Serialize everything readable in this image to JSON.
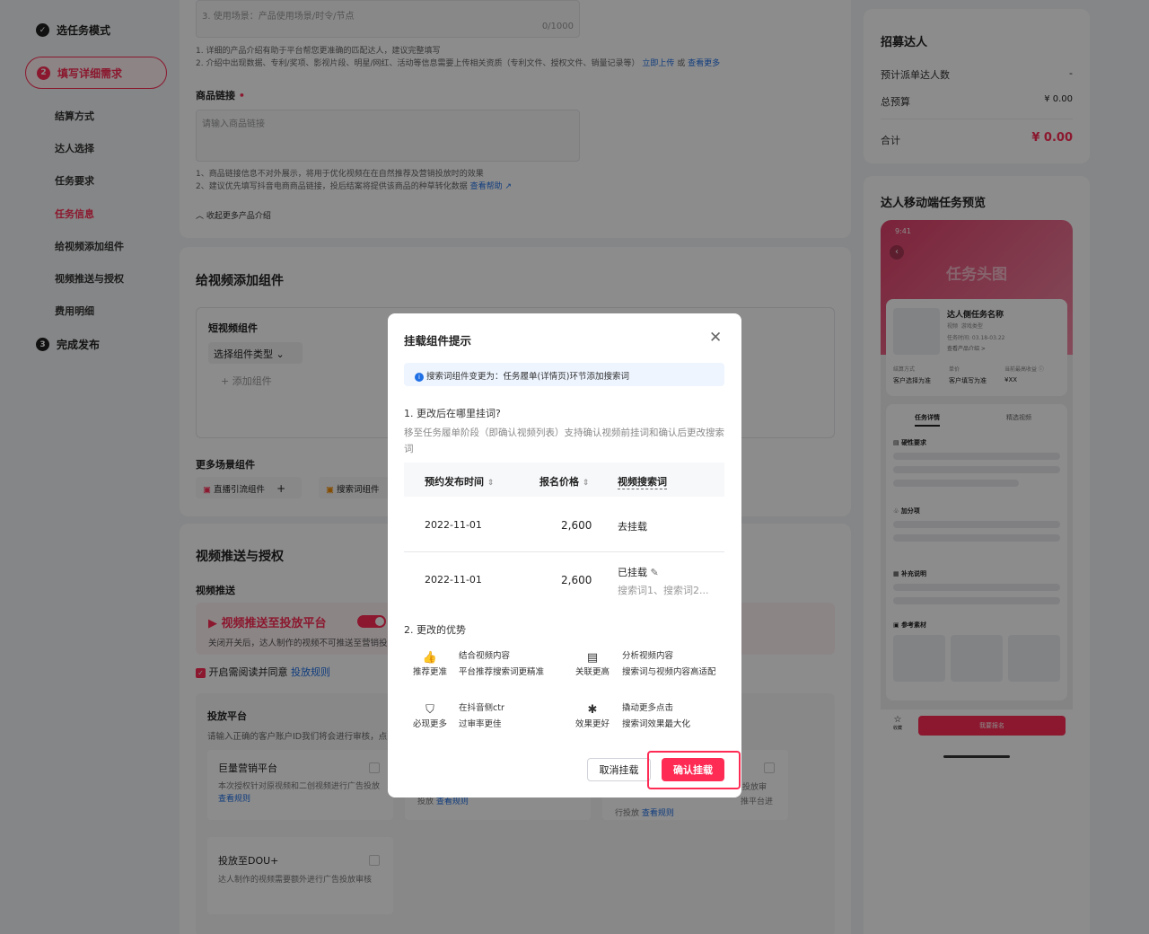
{
  "nav": {
    "step1": {
      "num": "✓",
      "label": "选任务模式"
    },
    "step2": {
      "num": "2",
      "label": "填写详细需求"
    },
    "step3": {
      "num": "3",
      "label": "完成发布"
    },
    "subs": [
      "结算方式",
      "达人选择",
      "任务要求",
      "任务信息",
      "给视频添加组件",
      "视频推送与授权",
      "费用明细"
    ]
  },
  "product": {
    "scene_placeholder": "3. 使用场景：产品使用场景/时令/节点",
    "counter": "0/1000",
    "tip1": "1. 详细的产品介绍有助于平台帮您更准确的匹配达人，建议完整填写",
    "tip2": "2. 介绍中出现数据、专利/奖项、影视片段、明星/网红、活动等信息需要上传相关资质（专利文件、授权文件、销量记录等）",
    "tip2_upload": "立即上传",
    "tip2_or": "或",
    "tip2_more": "查看更多",
    "link_label": "商品链接",
    "required": "•",
    "link_placeholder": "请输入商品链接",
    "link_tip1": "1、商品链接信息不对外展示，将用于优化视频在在自然推荐及营销投放时的效果",
    "link_tip2": "2、建议优先填写抖音电商商品链接，投后结案将提供该商品的种草转化数据",
    "link_help": "查看帮助",
    "collapse": "收起更多产品介绍"
  },
  "components": {
    "title": "给视频添加组件",
    "short_label": "短视频组件",
    "select_type": "选择组件类型",
    "add": "+ 添加组件",
    "more_label": "更多场景组件",
    "live": "直播引流组件",
    "search": "搜索词组件"
  },
  "push": {
    "title": "视频推送与授权",
    "sub": "视频推送",
    "banner_title": "视频推送至投放平台",
    "banner_desc": "关闭开关后，达人制作的视频不可推送至营销投",
    "agree_prefix": "开启需阅读并同意",
    "agree_link": "投放规则",
    "platform_title": "投放平台",
    "platform_desc": "请输入正确的客户账户ID我们将会进行审核，点",
    "p1_title": "巨量营销平台",
    "p1_desc": "本次授权针对原视频和二创视频进行广告投放",
    "p1_link": "查看规则",
    "p2_desc": "投放",
    "p2_link": "查看规则",
    "p3_desc1": "投放审",
    "p3_desc2": "推平台进",
    "p3_desc3": "行投放",
    "p3_link": "查看规则",
    "dou_title": "投放至DOU+",
    "dou_desc": "达人制作的视频需要额外进行广告投放审核"
  },
  "recruit": {
    "title": "招募达人",
    "row1_label": "预计派单达人数",
    "row1_value": "-",
    "row2_label": "总预算",
    "row2_value": "¥ 0.00",
    "total_label": "合计",
    "total_value": "¥ 0.00"
  },
  "preview": {
    "title": "达人移动端任务预览",
    "time": "9:41",
    "header": "任务头图",
    "task_name": "达人侧任务名称",
    "tag1": "视频",
    "tag2": "游戏类型",
    "task_time": "任务时间: 03.18-03.22",
    "product_intro": "查看产品介绍 >",
    "c1_label": "结算方式",
    "c1_value": "客户选择为准",
    "c2_label": "单价",
    "c2_value": "客户填写为准",
    "c3_label": "当前最高收益 ⓘ",
    "c3_value": "¥XX",
    "tab1": "任务详情",
    "tab2": "精选视频",
    "s1": "硬性要求",
    "s2": "加分项",
    "s3": "补充说明",
    "s4": "参考素材",
    "fav": "收藏",
    "signup": "我要报名"
  },
  "modal": {
    "title": "挂载组件提示",
    "info": "搜索词组件变更为：任务履单(详情页)环节添加搜索词",
    "q1": "1. 更改后在哪里挂词?",
    "q1_desc": "移至任务履单阶段（即确认视频列表）支持确认视频前挂词和确认后更改搜索词",
    "columns": [
      "预约发布时间",
      "报名价格",
      "视频搜索词"
    ],
    "rows": [
      {
        "date": "2022-11-01",
        "price": "2,600",
        "action": "去挂载"
      },
      {
        "date": "2022-11-01",
        "price": "2,600",
        "action": "已挂载",
        "words": "搜索词1、搜索词2..."
      }
    ],
    "q2": "2. 更改的优势",
    "advantages": [
      {
        "icon": "thumbs-up",
        "label": "推荐更准",
        "line1": "结合视频内容",
        "line2": "平台推荐搜索词更精准"
      },
      {
        "icon": "document",
        "label": "关联更高",
        "line1": "分析视频内容",
        "line2": "搜索词与视频内容高适配"
      },
      {
        "icon": "shield",
        "label": "必现更多",
        "line1": "在抖音侧ctr",
        "line2": "过审率更佳"
      },
      {
        "icon": "click",
        "label": "效果更好",
        "line1": "撬动更多点击",
        "line2": "搜索词效果最大化"
      }
    ],
    "cancel": "取消挂载",
    "confirm": "确认挂载"
  },
  "colors": {
    "accent": "#fe2c55",
    "link": "#1f6fe5"
  }
}
